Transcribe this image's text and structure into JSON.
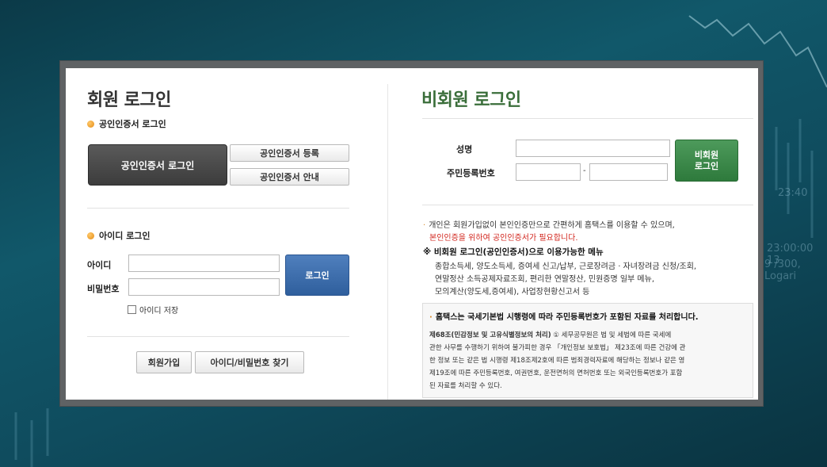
{
  "background": {
    "ticker_time_1": "23:40",
    "ticker_time_2": "23:00:00 13",
    "ticker_text": "9 /300, Logari"
  },
  "member_login": {
    "title": "회원 로그인",
    "cert_section_label": "공인인증서 로그인",
    "cert_login_button": "공인인증서 로그인",
    "cert_register_button": "공인인증서 등록",
    "cert_guide_button": "공인인증서 안내",
    "id_section_label": "아이디 로그인",
    "id_label": "아이디",
    "id_value": "",
    "password_label": "비밀번호",
    "password_value": "",
    "login_button": "로그인",
    "save_id_label": "아이디 저장",
    "signup_button": "회원가입",
    "find_button": "아이디/비밀번호 찾기"
  },
  "guest_login": {
    "title": "비회원 로그인",
    "name_label": "성명",
    "name_value": "",
    "rrn_label": "주민등록번호",
    "rrn_front_value": "",
    "rrn_separator": "-",
    "rrn_back_value": "",
    "login_button_line1": "비회원",
    "login_button_line2": "로그인",
    "info_line1": "개인은 회원가입없이 본인인증만으로 간편하게 홈택스를 이용할 수 있으며,",
    "info_line2": "본인인증을 위하여 공인인증서가 필요합니다.",
    "menu_title": "※ 비회원 로그인(공인인증서)으로 이용가능한 메뉴",
    "menu_line1": "종합소득세, 양도소득세, 증여세 신고/납부, 근로장려금 · 자녀장려금 신청/조회,",
    "menu_line2": "연말정산 소득공제자료조회, 편리한 연말정산, 민원증명 일부 메뉴,",
    "menu_line3": "모의계산(양도세,증여세), 사업장현황신고서 등",
    "notice_title": "홈택스는 국세기본법 시행령에 따라 주민등록번호가 포함된 자료를 처리합니다.",
    "notice_bold": "제68조(민감정보 및 고유식별정보의 처리)",
    "notice_line1": " ① 세무공무원은 법 및 세법에 따른 국세에",
    "notice_line2": "관한 사무를 수행하기 위하여 불가피한 경우 「개인정보 보호법」 제23조에 따른 건강에 관",
    "notice_line3": "한 정보 또는 같은 법 시행령 제18조제2호에 따른 범죄경력자료에 해당하는 정보나 같은 영",
    "notice_line4": "제19조에 따른 주민등록번호, 여권번호, 운전면허의 면허번호 또는 외국인등록번호가 포함",
    "notice_line5": "된 자료를 처리할 수 있다."
  }
}
